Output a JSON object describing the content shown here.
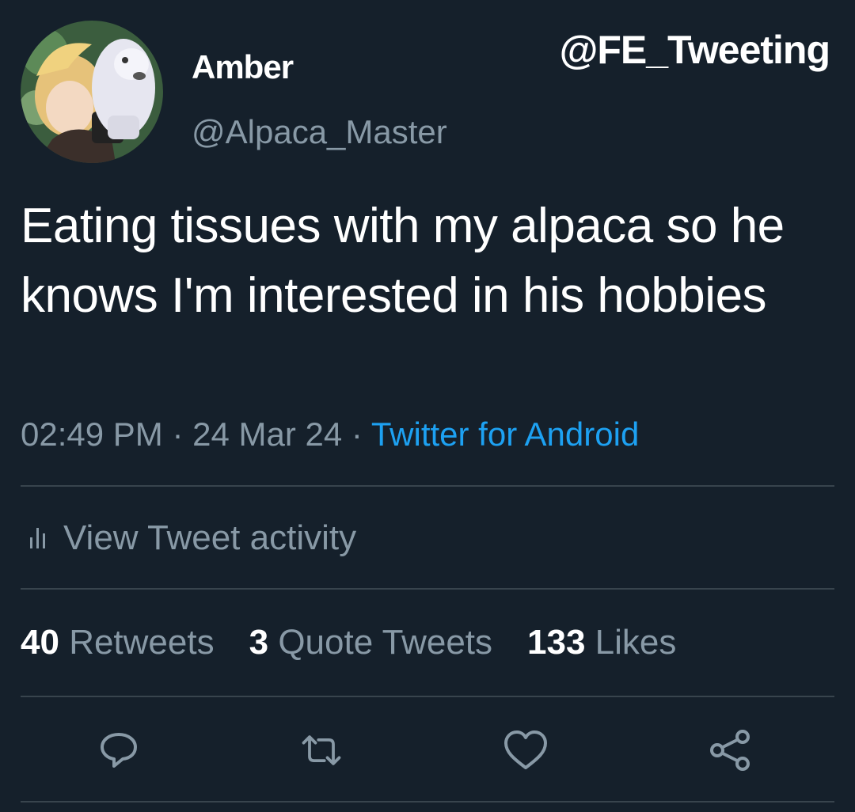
{
  "watermark": "@FE_Tweeting",
  "author": {
    "display_name": "Amber",
    "handle": "@Alpaca_Master",
    "avatar_icon": "avatar-image"
  },
  "tweet": {
    "text": "Eating tissues with my alpaca so he knows I'm interested in his hobbies",
    "time": "02:49 PM",
    "separator": "·",
    "date": "24 Mar 24",
    "source": "Twitter for Android"
  },
  "activity": {
    "label": "View Tweet activity",
    "icon": "bar-chart-icon"
  },
  "stats": {
    "retweets": {
      "count": "40",
      "label": "Retweets"
    },
    "quotes": {
      "count": "3",
      "label": "Quote Tweets"
    },
    "likes": {
      "count": "133",
      "label": "Likes"
    }
  },
  "actions": [
    {
      "name": "reply",
      "icon": "reply-icon"
    },
    {
      "name": "retweet",
      "icon": "retweet-icon"
    },
    {
      "name": "like",
      "icon": "heart-icon"
    },
    {
      "name": "share",
      "icon": "share-icon"
    }
  ],
  "colors": {
    "background": "#15202b",
    "text_primary": "#ffffff",
    "text_secondary": "#8899a6",
    "link": "#1da1f2",
    "divider": "#38444d"
  }
}
